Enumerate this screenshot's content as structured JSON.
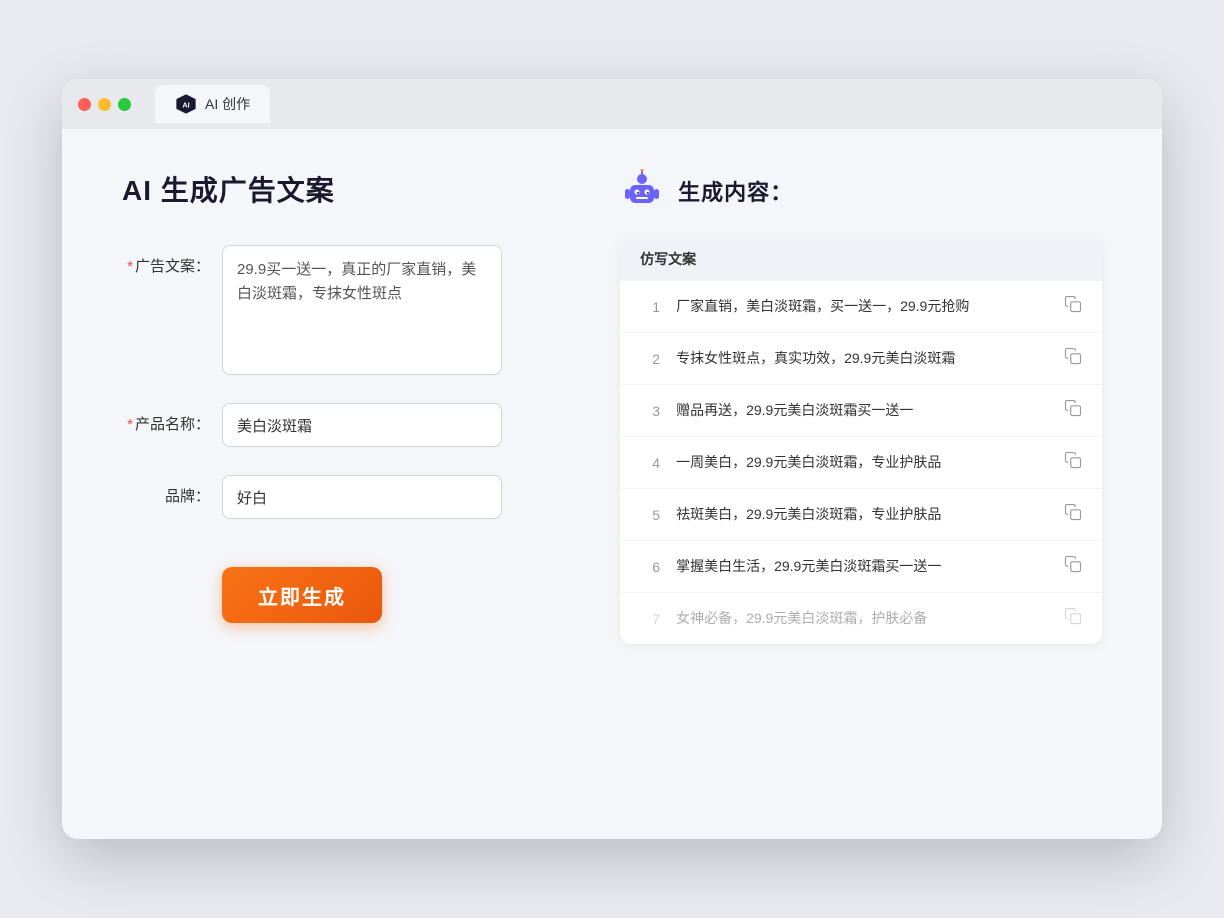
{
  "browser": {
    "tab_label": "AI 创作"
  },
  "left_panel": {
    "title": "AI 生成广告文案",
    "form": {
      "ad_copy_label": "广告文案：",
      "ad_copy_required": "＊",
      "ad_copy_value": "29.9买一送一，真正的厂家直销，美白淡斑霜，专抹女性斑点",
      "product_name_label": "产品名称：",
      "product_name_required": "＊",
      "product_name_value": "美白淡斑霜",
      "brand_label": "品牌：",
      "brand_value": "好白"
    },
    "generate_button": "立即生成"
  },
  "right_panel": {
    "title": "生成内容：",
    "table_header": "仿写文案",
    "results": [
      {
        "number": "1",
        "text": "厂家直销，美白淡斑霜，买一送一，29.9元抢购",
        "dimmed": false
      },
      {
        "number": "2",
        "text": "专抹女性斑点，真实功效，29.9元美白淡斑霜",
        "dimmed": false
      },
      {
        "number": "3",
        "text": "赠品再送，29.9元美白淡斑霜买一送一",
        "dimmed": false
      },
      {
        "number": "4",
        "text": "一周美白，29.9元美白淡斑霜，专业护肤品",
        "dimmed": false
      },
      {
        "number": "5",
        "text": "祛斑美白，29.9元美白淡斑霜，专业护肤品",
        "dimmed": false
      },
      {
        "number": "6",
        "text": "掌握美白生活，29.9元美白淡斑霜买一送一",
        "dimmed": false
      },
      {
        "number": "7",
        "text": "女神必备，29.9元美白淡斑霜，护肤必备",
        "dimmed": true
      }
    ]
  }
}
